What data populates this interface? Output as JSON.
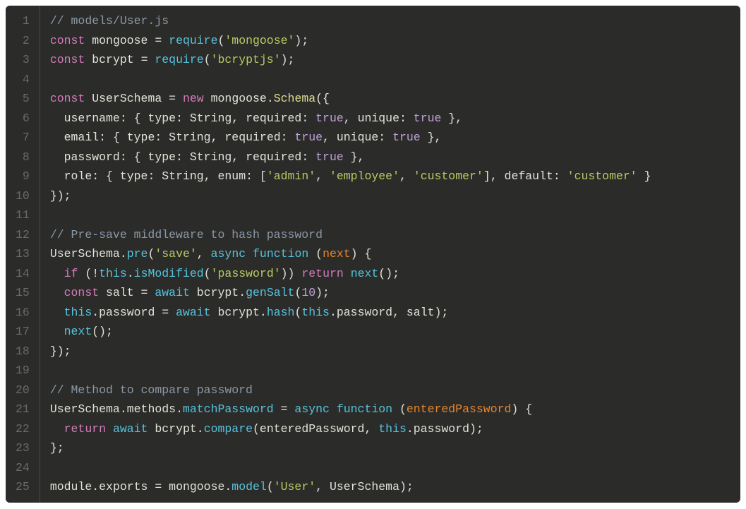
{
  "lineCount": 25,
  "code": {
    "l1": [
      [
        "cm",
        "// models/User.js"
      ]
    ],
    "l2": [
      [
        "kw",
        "const"
      ],
      [
        "pn",
        " "
      ],
      [
        "id",
        "mongoose"
      ],
      [
        "pn",
        " "
      ],
      [
        "pn",
        "="
      ],
      [
        "pn",
        " "
      ],
      [
        "fn",
        "require"
      ],
      [
        "pn",
        "("
      ],
      [
        "str",
        "'mongoose'"
      ],
      [
        "pn",
        ")"
      ],
      [
        "pn",
        ";"
      ]
    ],
    "l3": [
      [
        "kw",
        "const"
      ],
      [
        "pn",
        " "
      ],
      [
        "id",
        "bcrypt"
      ],
      [
        "pn",
        " "
      ],
      [
        "pn",
        "="
      ],
      [
        "pn",
        " "
      ],
      [
        "fn",
        "require"
      ],
      [
        "pn",
        "("
      ],
      [
        "str",
        "'bcryptjs'"
      ],
      [
        "pn",
        ")"
      ],
      [
        "pn",
        ";"
      ]
    ],
    "l4": [
      [
        "pn",
        ""
      ]
    ],
    "l5": [
      [
        "kw",
        "const"
      ],
      [
        "pn",
        " "
      ],
      [
        "id",
        "UserSchema"
      ],
      [
        "pn",
        " "
      ],
      [
        "pn",
        "="
      ],
      [
        "pn",
        " "
      ],
      [
        "kw",
        "new"
      ],
      [
        "pn",
        " "
      ],
      [
        "id",
        "mongoose"
      ],
      [
        "pn",
        "."
      ],
      [
        "ye",
        "Schema"
      ],
      [
        "pn",
        "({"
      ]
    ],
    "l6": [
      [
        "pn",
        "  "
      ],
      [
        "id",
        "username"
      ],
      [
        "pn",
        ": { "
      ],
      [
        "id",
        "type"
      ],
      [
        "pn",
        ": "
      ],
      [
        "id",
        "String"
      ],
      [
        "pn",
        ", "
      ],
      [
        "id",
        "required"
      ],
      [
        "pn",
        ": "
      ],
      [
        "bool",
        "true"
      ],
      [
        "pn",
        ", "
      ],
      [
        "id",
        "unique"
      ],
      [
        "pn",
        ": "
      ],
      [
        "bool",
        "true"
      ],
      [
        "pn",
        " },"
      ]
    ],
    "l7": [
      [
        "pn",
        "  "
      ],
      [
        "id",
        "email"
      ],
      [
        "pn",
        ": { "
      ],
      [
        "id",
        "type"
      ],
      [
        "pn",
        ": "
      ],
      [
        "id",
        "String"
      ],
      [
        "pn",
        ", "
      ],
      [
        "id",
        "required"
      ],
      [
        "pn",
        ": "
      ],
      [
        "bool",
        "true"
      ],
      [
        "pn",
        ", "
      ],
      [
        "id",
        "unique"
      ],
      [
        "pn",
        ": "
      ],
      [
        "bool",
        "true"
      ],
      [
        "pn",
        " },"
      ]
    ],
    "l8": [
      [
        "pn",
        "  "
      ],
      [
        "id",
        "password"
      ],
      [
        "pn",
        ": { "
      ],
      [
        "id",
        "type"
      ],
      [
        "pn",
        ": "
      ],
      [
        "id",
        "String"
      ],
      [
        "pn",
        ", "
      ],
      [
        "id",
        "required"
      ],
      [
        "pn",
        ": "
      ],
      [
        "bool",
        "true"
      ],
      [
        "pn",
        " },"
      ]
    ],
    "l9": [
      [
        "pn",
        "  "
      ],
      [
        "id",
        "role"
      ],
      [
        "pn",
        ": { "
      ],
      [
        "id",
        "type"
      ],
      [
        "pn",
        ": "
      ],
      [
        "id",
        "String"
      ],
      [
        "pn",
        ", "
      ],
      [
        "id",
        "enum"
      ],
      [
        "pn",
        ": ["
      ],
      [
        "str",
        "'admin'"
      ],
      [
        "pn",
        ", "
      ],
      [
        "str",
        "'employee'"
      ],
      [
        "pn",
        ", "
      ],
      [
        "str",
        "'customer'"
      ],
      [
        "pn",
        "], "
      ],
      [
        "id",
        "default"
      ],
      [
        "pn",
        ": "
      ],
      [
        "str",
        "'customer'"
      ],
      [
        "pn",
        " }"
      ]
    ],
    "l10": [
      [
        "pn",
        "});"
      ]
    ],
    "l11": [
      [
        "pn",
        ""
      ]
    ],
    "l12": [
      [
        "cm",
        "// Pre-save middleware to hash password"
      ]
    ],
    "l13": [
      [
        "id",
        "UserSchema"
      ],
      [
        "pn",
        "."
      ],
      [
        "fn",
        "pre"
      ],
      [
        "pn",
        "("
      ],
      [
        "str",
        "'save'"
      ],
      [
        "pn",
        ", "
      ],
      [
        "kw2",
        "async"
      ],
      [
        "pn",
        " "
      ],
      [
        "kw2",
        "function"
      ],
      [
        "pn",
        " ("
      ],
      [
        "prm",
        "next"
      ],
      [
        "pn",
        ") {"
      ]
    ],
    "l14": [
      [
        "pn",
        "  "
      ],
      [
        "kw",
        "if"
      ],
      [
        "pn",
        " (!"
      ],
      [
        "kw2",
        "this"
      ],
      [
        "pn",
        "."
      ],
      [
        "fn",
        "isModified"
      ],
      [
        "pn",
        "("
      ],
      [
        "str",
        "'password'"
      ],
      [
        "pn",
        ")) "
      ],
      [
        "kw",
        "return"
      ],
      [
        "pn",
        " "
      ],
      [
        "fn",
        "next"
      ],
      [
        "pn",
        "();"
      ]
    ],
    "l15": [
      [
        "pn",
        "  "
      ],
      [
        "kw",
        "const"
      ],
      [
        "pn",
        " "
      ],
      [
        "id",
        "salt"
      ],
      [
        "pn",
        " = "
      ],
      [
        "kw2",
        "await"
      ],
      [
        "pn",
        " "
      ],
      [
        "id",
        "bcrypt"
      ],
      [
        "pn",
        "."
      ],
      [
        "fn",
        "genSalt"
      ],
      [
        "pn",
        "("
      ],
      [
        "num",
        "10"
      ],
      [
        "pn",
        ");"
      ]
    ],
    "l16": [
      [
        "pn",
        "  "
      ],
      [
        "kw2",
        "this"
      ],
      [
        "pn",
        "."
      ],
      [
        "id",
        "password"
      ],
      [
        "pn",
        " = "
      ],
      [
        "kw2",
        "await"
      ],
      [
        "pn",
        " "
      ],
      [
        "id",
        "bcrypt"
      ],
      [
        "pn",
        "."
      ],
      [
        "fn",
        "hash"
      ],
      [
        "pn",
        "("
      ],
      [
        "kw2",
        "this"
      ],
      [
        "pn",
        "."
      ],
      [
        "id",
        "password"
      ],
      [
        "pn",
        ", "
      ],
      [
        "id",
        "salt"
      ],
      [
        "pn",
        ");"
      ]
    ],
    "l17": [
      [
        "pn",
        "  "
      ],
      [
        "fn",
        "next"
      ],
      [
        "pn",
        "();"
      ]
    ],
    "l18": [
      [
        "pn",
        "});"
      ]
    ],
    "l19": [
      [
        "pn",
        ""
      ]
    ],
    "l20": [
      [
        "cm",
        "// Method to compare password"
      ]
    ],
    "l21": [
      [
        "id",
        "UserSchema"
      ],
      [
        "pn",
        "."
      ],
      [
        "id",
        "methods"
      ],
      [
        "pn",
        "."
      ],
      [
        "fn",
        "matchPassword"
      ],
      [
        "pn",
        " = "
      ],
      [
        "kw2",
        "async"
      ],
      [
        "pn",
        " "
      ],
      [
        "kw2",
        "function"
      ],
      [
        "pn",
        " ("
      ],
      [
        "prm",
        "enteredPassword"
      ],
      [
        "pn",
        ") {"
      ]
    ],
    "l22": [
      [
        "pn",
        "  "
      ],
      [
        "kw",
        "return"
      ],
      [
        "pn",
        " "
      ],
      [
        "kw2",
        "await"
      ],
      [
        "pn",
        " "
      ],
      [
        "id",
        "bcrypt"
      ],
      [
        "pn",
        "."
      ],
      [
        "fn",
        "compare"
      ],
      [
        "pn",
        "("
      ],
      [
        "id",
        "enteredPassword"
      ],
      [
        "pn",
        ", "
      ],
      [
        "kw2",
        "this"
      ],
      [
        "pn",
        "."
      ],
      [
        "id",
        "password"
      ],
      [
        "pn",
        ");"
      ]
    ],
    "l23": [
      [
        "pn",
        "};"
      ]
    ],
    "l24": [
      [
        "pn",
        ""
      ]
    ],
    "l25": [
      [
        "id",
        "module"
      ],
      [
        "pn",
        "."
      ],
      [
        "id",
        "exports"
      ],
      [
        "pn",
        " = "
      ],
      [
        "id",
        "mongoose"
      ],
      [
        "pn",
        "."
      ],
      [
        "fn",
        "model"
      ],
      [
        "pn",
        "("
      ],
      [
        "str",
        "'User'"
      ],
      [
        "pn",
        ", "
      ],
      [
        "id",
        "UserSchema"
      ],
      [
        "pn",
        ");"
      ]
    ]
  }
}
